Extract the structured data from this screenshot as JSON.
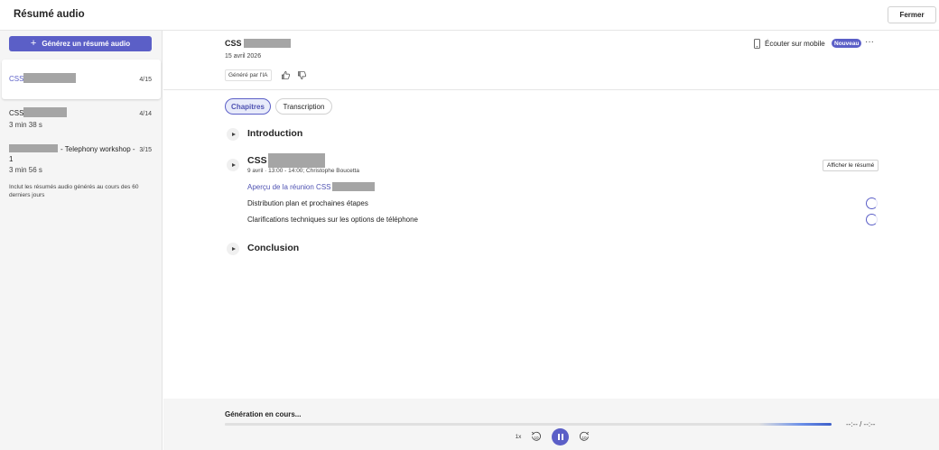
{
  "app": {
    "title": "Résumé audio",
    "close_label": "Fermer"
  },
  "sidebar": {
    "generate_label": "Générez un résumé audio",
    "items": [
      {
        "title": "CSS",
        "date": "4/15",
        "duration": "",
        "active": true
      },
      {
        "title": "CSS",
        "date": "4/14",
        "duration": "3 min 38 s",
        "active": false
      },
      {
        "title_suffix": "- Telephony workshop -",
        "title_line2": "1",
        "date": "3/15",
        "duration": "3 min 56 s",
        "active": false
      }
    ],
    "note": "Inclut les résumés audio générés au cours des 60 derniers jours"
  },
  "header": {
    "title": "CSS",
    "date": "15 avril 2026",
    "ai_badge": "Généré par l'IA",
    "mobile_label": "Écouter sur mobile",
    "new_badge": "Nouveau"
  },
  "tabs": [
    {
      "label": "Chapitres",
      "selected": true
    },
    {
      "label": "Transcription",
      "selected": false
    }
  ],
  "chapters": {
    "intro": {
      "title": "Introduction"
    },
    "main": {
      "title": "CSS",
      "meta": "9 avril · 13:00 - 14:00; Christophe Boucetta",
      "show_summary_label": "Afficher le résumé",
      "overview_link": "Aperçu de la réunion CSS",
      "items": [
        {
          "label": "Distribution plan et prochaines étapes"
        },
        {
          "label": "Clarifications techniques sur les options de téléphone"
        }
      ]
    },
    "conclusion": {
      "title": "Conclusion"
    }
  },
  "player": {
    "status": "Génération en cours...",
    "time_readout": "--:-- / --:--",
    "speed_label": "1x",
    "rewind_label": "10",
    "forward_label": "10",
    "progress_percent": 100
  },
  "colors": {
    "accent": "#5b5fc7",
    "accent_text": "#4f52b2"
  },
  "icons": [
    "plus-icon",
    "thumbs-up-icon",
    "thumbs-down-icon",
    "phone-icon",
    "more-icon",
    "play-icon",
    "spinner-icon",
    "rewind-10-icon",
    "pause-icon",
    "forward-10-icon"
  ]
}
